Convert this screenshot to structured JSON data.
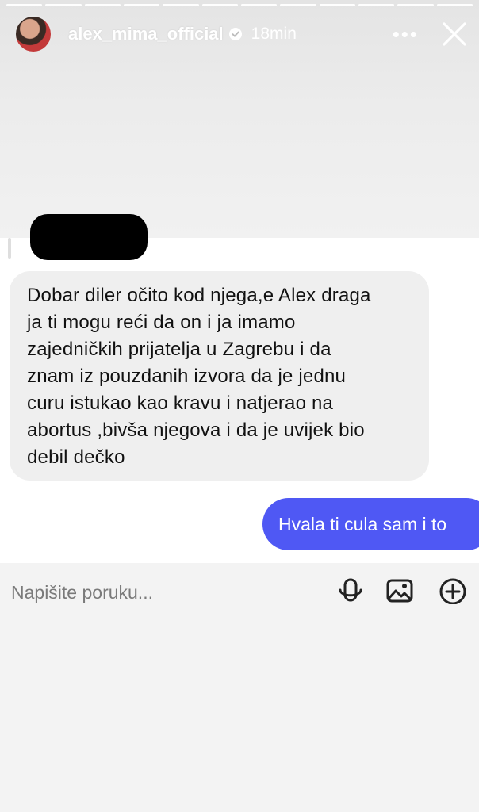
{
  "story": {
    "username": "alex_mima_official",
    "time_ago": "18min",
    "more_label": "•••",
    "segment_count": 12
  },
  "chat": {
    "incoming_lines": [
      "Dobar diler očito kod njega,e Alex draga",
      "ja ti mogu reći da on i ja imamo",
      "zajedničkih prijatelja u Zagrebu i da",
      "znam iz pouzdanih izvora da je jednu",
      "curu istukao kao kravu i natjerao na",
      "abortus ,bivša njegova i da je uvijek bio",
      "debil dečko"
    ],
    "outgoing_message": "Hvala ti cula sam i to"
  },
  "composer": {
    "placeholder": "Napišite poruku...",
    "icons": [
      "microphone-icon",
      "image-icon",
      "add-circle-icon"
    ]
  },
  "colors": {
    "outgoing_bubble": "#4f58f4",
    "incoming_bubble": "#efefef",
    "background": "#f2f2f2"
  }
}
